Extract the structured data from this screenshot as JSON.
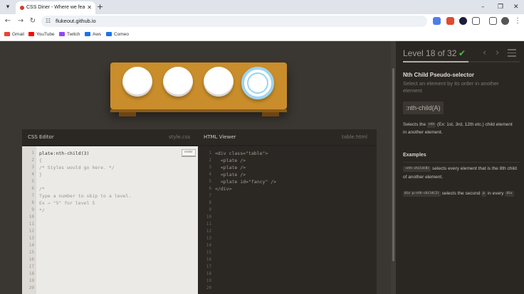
{
  "browser": {
    "tab_title": "CSS Diner - Where we feast on",
    "url": "flukeout.github.io",
    "new_tab": "+",
    "bookmarks": [
      {
        "label": "Gmail",
        "icon": "gmail-icon",
        "color": "#ea4335"
      },
      {
        "label": "YouTube",
        "icon": "youtube-icon",
        "color": "#ff0000"
      },
      {
        "label": "Twitch",
        "icon": "twitch-icon",
        "color": "#9146ff"
      },
      {
        "label": "Aws",
        "icon": "aws-icon",
        "color": "#1a73e8"
      },
      {
        "label": "Comeo",
        "icon": "comeo-icon",
        "color": "#1a73e8"
      }
    ]
  },
  "game": {
    "plates": [
      {
        "kind": "plate"
      },
      {
        "kind": "plate"
      },
      {
        "kind": "plate"
      },
      {
        "kind": "fancy"
      }
    ]
  },
  "css_editor": {
    "title": "CSS Editor",
    "filename": "style.css",
    "input_value": "plate:nth-child(3)",
    "enter_label": "enter",
    "line_count": 20,
    "lines": [
      "",
      "{",
      "/* Styles would go here. */",
      "}",
      "",
      "/*",
      "Type a number to skip to a level.",
      "Ex → \"5\" for level 5",
      "*/"
    ]
  },
  "html_viewer": {
    "title": "HTML Viewer",
    "filename": "table.html",
    "line_count": 20,
    "lines": [
      "<div class=\"table\">",
      "  <plate />",
      "  <plate />",
      "  <plate />",
      "  <plate id=\"fancy\" />",
      "</div>"
    ]
  },
  "sidebar": {
    "level_text": "Level 18 of 32",
    "completed_icon": "check-icon",
    "progress": 0.5625,
    "hint_title": "Nth Child Pseudo-selector",
    "hint_subtitle": "Select an element by its order in another element",
    "syntax": ":nth-child(A)",
    "desc_before": "Selects the",
    "desc_tag": "nth",
    "desc_after": "(Ex: 1st, 3rd, 12th etc.) child element in another element.",
    "examples_title": "Examples",
    "example1_code": ":nth-child(8)",
    "example1_text": "selects every element that is the 8th child of another element.",
    "example2_code": "div p:nth-child(2)",
    "example2_mid": "selects the second",
    "example2_tag1": "p",
    "example2_after": "in every",
    "example2_tag2": "div"
  }
}
